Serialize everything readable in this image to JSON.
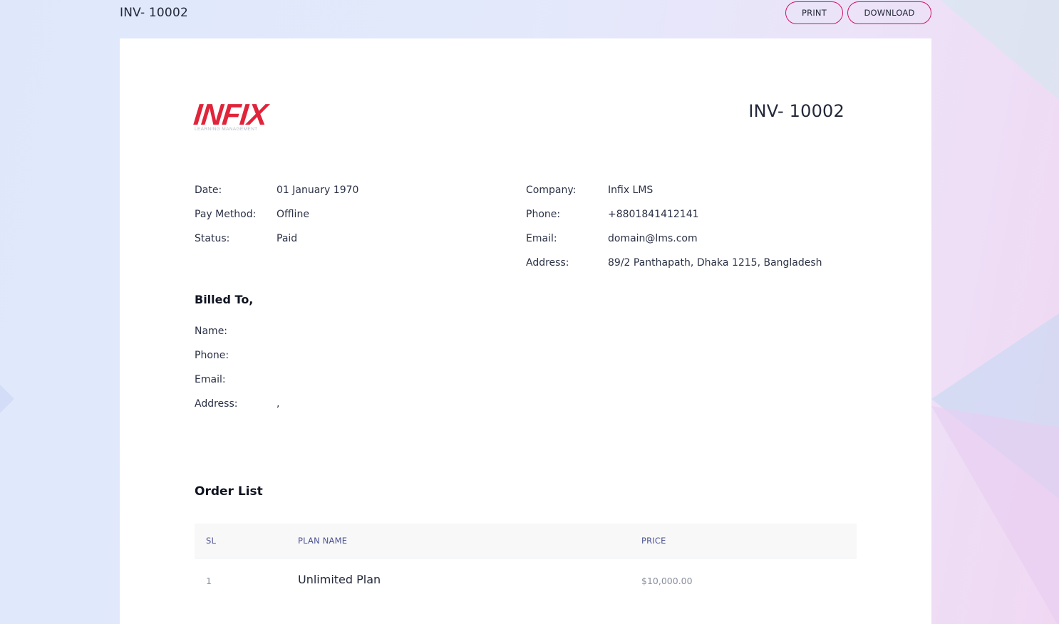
{
  "page": {
    "title": "INV- 10002"
  },
  "actions": {
    "print_label": "PRINT",
    "download_label": "DOWNLOAD"
  },
  "invoice": {
    "logo_text": "INFIX",
    "logo_subtext": "LEARNING MANAGEMENT",
    "number": "INV- 10002",
    "meta": [
      {
        "label": "Date:",
        "value": "01 January 1970"
      },
      {
        "label": "Pay Method:",
        "value": "Offline"
      },
      {
        "label": "Status:",
        "value": "Paid"
      }
    ],
    "company": [
      {
        "label": "Company:",
        "value": "Infix LMS"
      },
      {
        "label": "Phone:",
        "value": "+8801841412141"
      },
      {
        "label": "Email:",
        "value": "domain@lms.com"
      },
      {
        "label": "Address:",
        "value": "89/2 Panthapath, Dhaka 1215, Bangladesh"
      }
    ],
    "billed_to": {
      "heading": "Billed To,",
      "fields": [
        {
          "label": "Name:",
          "value": ""
        },
        {
          "label": "Phone:",
          "value": ""
        },
        {
          "label": "Email:",
          "value": ""
        },
        {
          "label": "Address:",
          "value": ","
        }
      ]
    },
    "order_list": {
      "heading": "Order List",
      "columns": [
        "SL",
        "PLAN NAME",
        "PRICE"
      ],
      "rows": [
        {
          "sl": "1",
          "plan": "Unlimited Plan",
          "price": "$10,000.00"
        }
      ]
    }
  },
  "colors": {
    "accent": "#d1136a",
    "logo_red": "#e0243a",
    "header_text": "#4a5190"
  },
  "icons": []
}
